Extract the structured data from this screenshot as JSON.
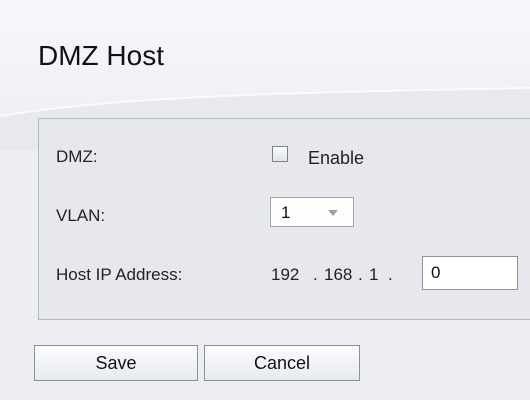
{
  "page_title": "DMZ Host",
  "dmz": {
    "label": "DMZ:",
    "checkbox_label": "Enable",
    "checked": false
  },
  "vlan": {
    "label": "VLAN:",
    "selected": "1"
  },
  "host_ip": {
    "label": "Host IP Address:",
    "octet1": "192",
    "octet2": "168",
    "octet3": "1",
    "octet4_value": "0",
    "separator": "."
  },
  "buttons": {
    "save": "Save",
    "cancel": "Cancel"
  },
  "icons": {
    "vlan_dropdown": "chevron-down-icon"
  }
}
